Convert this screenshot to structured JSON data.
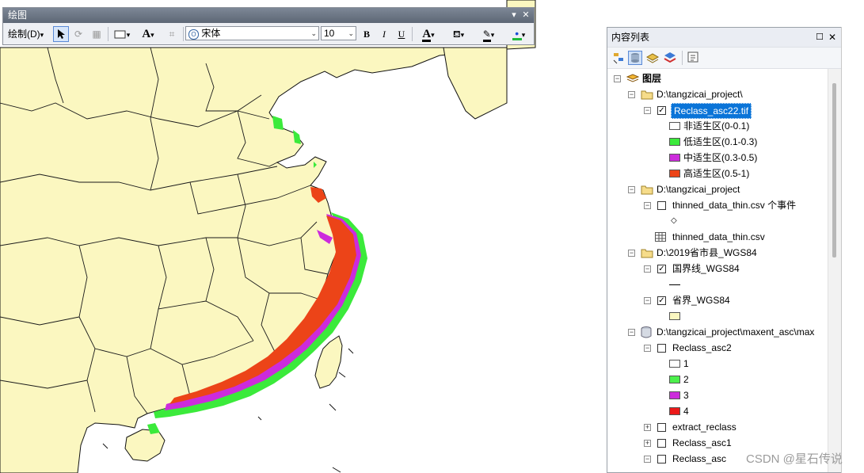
{
  "colors": {
    "land": "#fbf7c0",
    "sea": "#ffffff",
    "border": "#1a1a1a",
    "low": "#3bea3b",
    "mid": "#cc2bdc",
    "high": "#ec4418",
    "selection": "#0a74d8"
  },
  "toolbar": {
    "title": "绘图",
    "draw_menu": "绘制(D)",
    "font_name": "宋体",
    "font_size": "10",
    "bold": "B",
    "italic": "I",
    "underline": "U",
    "text_tool": "A",
    "font_color": "A"
  },
  "toc": {
    "title": "内容列表",
    "root": "图层",
    "group1": "D:\\tangzicai_project\\",
    "layer1": "Reclass_asc22.tif",
    "layer1_classes": [
      "非适生区(0-0.1)",
      "低适生区(0.1-0.3)",
      "中适生区(0.3-0.5)",
      "高适生区(0.5-1)"
    ],
    "group2": "D:\\tangzicai_project",
    "events_layer": "thinned_data_thin.csv 个事件",
    "table_item": "thinned_data_thin.csv",
    "group3": "D:\\2019省市县_WGS84",
    "layer_country": "国界线_WGS84",
    "layer_province": "省界_WGS84",
    "group4": "D:\\tangzicai_project\\maxent_asc\\max",
    "layer_reclass2": "Reclass_asc2",
    "reclass2_classes": [
      "1",
      "2",
      "3",
      "4"
    ],
    "layer_extract": "extract_reclass",
    "layer_asc1": "Reclass_asc1",
    "layer_asc": "Reclass_asc"
  },
  "watermark": "CSDN @星石传说"
}
